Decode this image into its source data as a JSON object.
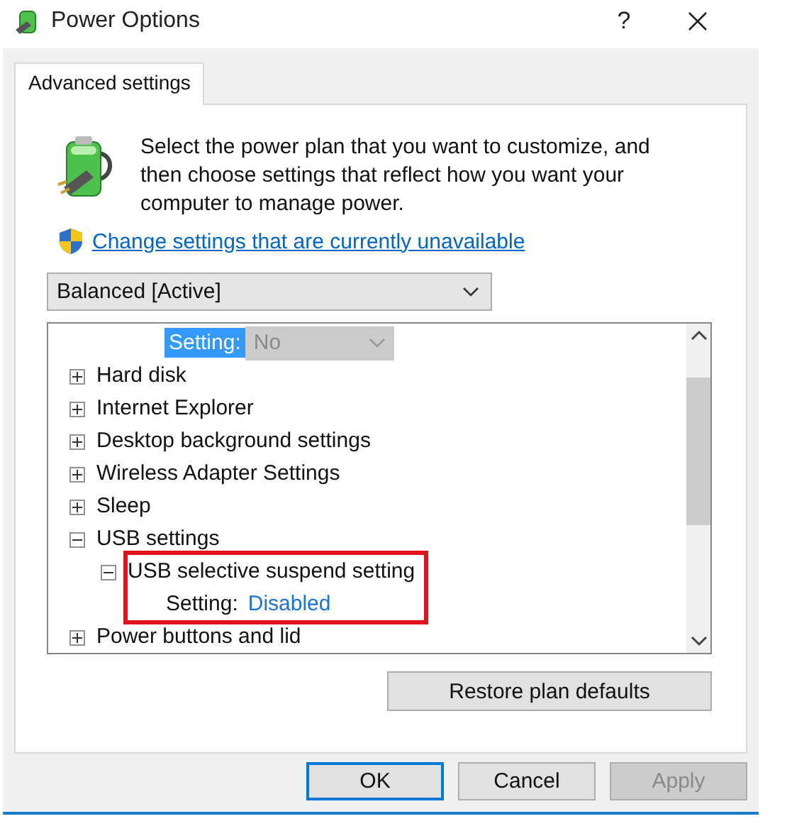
{
  "window": {
    "title": "Power Options",
    "help": "?"
  },
  "tabs": [
    {
      "label": "Advanced settings",
      "selected": true
    }
  ],
  "intro": "Select the power plan that you want to customize, and then choose settings that reflect how you want your computer to manage power.",
  "link": "Change settings that are currently unavailable",
  "plan_select": {
    "value": "Balanced [Active]"
  },
  "tree": [
    {
      "kind": "setting",
      "label": "Setting:",
      "value": "No",
      "selected": true
    },
    {
      "kind": "category",
      "label": "Hard disk",
      "expanded": false
    },
    {
      "kind": "category",
      "label": "Internet Explorer",
      "expanded": false
    },
    {
      "kind": "category",
      "label": "Desktop background settings",
      "expanded": false
    },
    {
      "kind": "category",
      "label": "Wireless Adapter Settings",
      "expanded": false
    },
    {
      "kind": "category",
      "label": "Sleep",
      "expanded": false
    },
    {
      "kind": "category",
      "label": "USB settings",
      "expanded": true,
      "children": [
        {
          "kind": "category",
          "label": "USB selective suspend setting",
          "expanded": true,
          "highlighted": true,
          "children": [
            {
              "kind": "setting",
              "label": "Setting:",
              "value": "Disabled",
              "selected": false
            }
          ]
        }
      ]
    },
    {
      "kind": "category",
      "label": "Power buttons and lid",
      "expanded": false
    }
  ],
  "restore_button": "Restore plan defaults",
  "buttons": [
    {
      "label": "OK",
      "default": true,
      "disabled": false
    },
    {
      "label": "Cancel",
      "default": false,
      "disabled": false
    },
    {
      "label": "Apply",
      "default": false,
      "disabled": true
    }
  ]
}
